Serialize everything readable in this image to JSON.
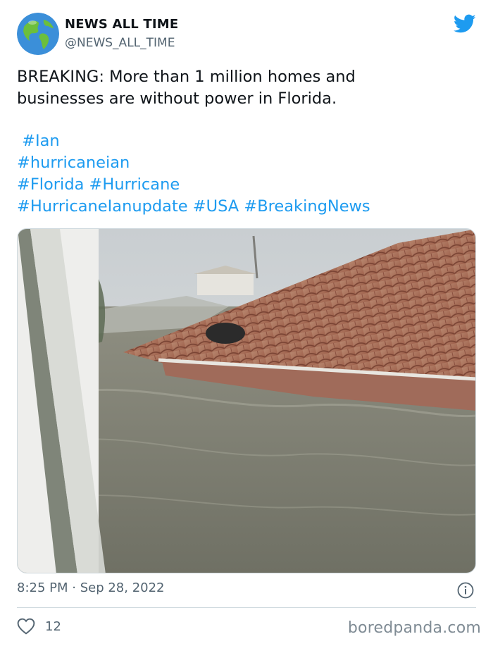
{
  "account": {
    "name": "NEWS ALL TIME",
    "handle": "@NEWS_ALL_TIME",
    "avatar_icon": "globe-icon"
  },
  "tweet": {
    "lines": [
      "BREAKING: More than 1 million homes and",
      "businesses are without power in Florida."
    ],
    "hashtags": [
      [
        "#Ian"
      ],
      [
        "#hurricaneian"
      ],
      [
        "#Florida",
        "#Hurricane"
      ],
      [
        "#HurricaneIanupdate",
        "#USA",
        "#BreakingNews"
      ]
    ]
  },
  "timestamp": "8:25 PM · Sep 28, 2022",
  "likes": "12",
  "watermark": "boredpanda.com",
  "colors": {
    "link": "#1d9bf0",
    "muted": "#536471",
    "twitter_blue": "#1d9bf0"
  },
  "icons": [
    "twitter-bird-icon",
    "info-icon",
    "heart-icon"
  ]
}
